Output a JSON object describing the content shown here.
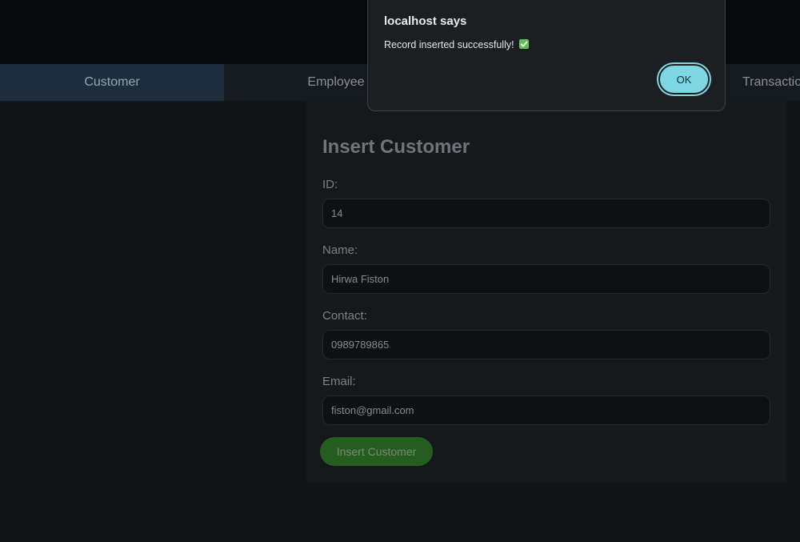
{
  "nav": {
    "tabs": [
      {
        "label": "Customer",
        "active": true
      },
      {
        "label": "Employee",
        "active": false
      },
      {
        "label": "Transactio",
        "active": false
      }
    ]
  },
  "form": {
    "title": "Insert Customer",
    "fields": [
      {
        "label": "ID:",
        "value": "14"
      },
      {
        "label": "Name:",
        "value": "Hirwa Fiston"
      },
      {
        "label": "Contact:",
        "value": "0989789865"
      },
      {
        "label": "Email:",
        "value": "fiston@gmail.com"
      }
    ],
    "submit_label": "Insert Customer"
  },
  "dialog": {
    "title": "localhost says",
    "message": "Record inserted successfully!",
    "message_icon": "check-mark-emoji",
    "ok_label": "OK"
  },
  "colors": {
    "accent": "#7dd8e4",
    "submit": "#255c1f",
    "active_tab": "#1e2d3c",
    "check": "#5fc15a"
  }
}
